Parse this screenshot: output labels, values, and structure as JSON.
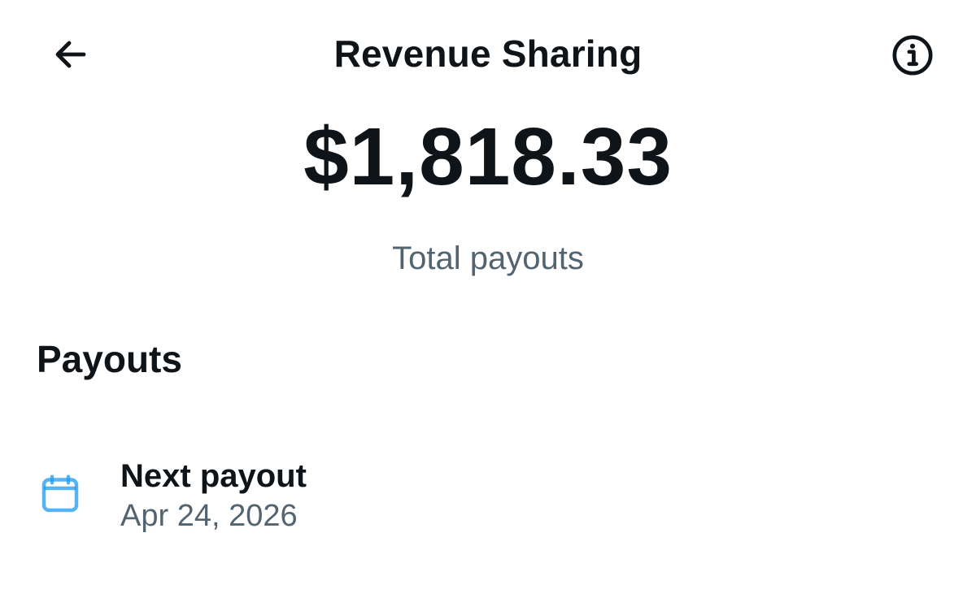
{
  "header": {
    "title": "Revenue Sharing",
    "back_icon": "arrow-left-icon",
    "info_icon": "info-circle-icon"
  },
  "summary": {
    "total_amount": "$1,818.33",
    "total_label": "Total payouts"
  },
  "payouts": {
    "section_title": "Payouts",
    "next_payout": {
      "icon": "calendar-icon",
      "label": "Next payout",
      "date": "Apr 24, 2026"
    }
  },
  "colors": {
    "text_primary": "#0f1419",
    "text_secondary": "#536471",
    "accent_blue": "#1d9bf0",
    "background": "#ffffff"
  }
}
